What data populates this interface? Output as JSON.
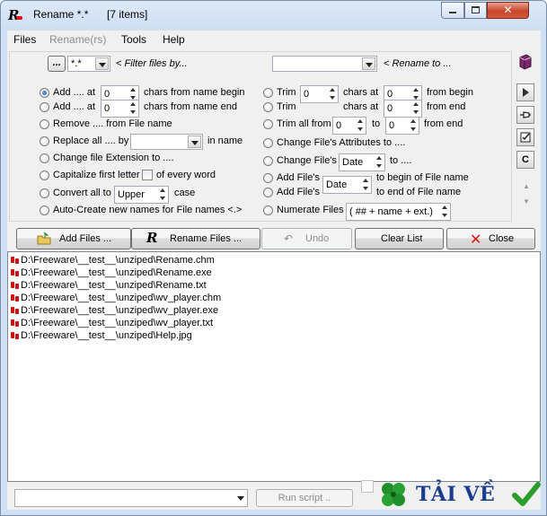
{
  "window": {
    "app_icon_letter": "R",
    "title": "Rename  *.*",
    "item_count": "[7 items]"
  },
  "menu": {
    "files": "Files",
    "rename": "Rename(rs)",
    "tools": "Tools",
    "help": "Help"
  },
  "filter": {
    "button_label": "...",
    "value": "*.*",
    "hint": "< Filter files by..."
  },
  "rename_to": {
    "value": "",
    "hint": "< Rename to ..."
  },
  "options": {
    "add_start": {
      "label": "Add .... at",
      "value": "0",
      "suffix": "chars from name begin",
      "checked": true
    },
    "add_end": {
      "label": "Add .... at",
      "value": "0",
      "suffix": "chars from name end"
    },
    "remove": {
      "label": "Remove  ....  from File name"
    },
    "replace": {
      "label": "Replace all .... by",
      "suffix": "in name",
      "value": ""
    },
    "change_ext": {
      "label": "Change file Extension to ...."
    },
    "capitalize": {
      "label": "Capitalize first letter",
      "check_label": "of every word"
    },
    "convert": {
      "label": "Convert all to",
      "value": "Upper",
      "suffix": "case"
    },
    "autocreate": {
      "label": "Auto-Create new names for File names <.>"
    },
    "trim": {
      "label": "Trim",
      "value": "0",
      "suffix": "chars at",
      "value2": "0",
      "suffix2": "from begin"
    },
    "trim2": {
      "label": "Trim",
      "suffix": "chars at",
      "value2": "0",
      "suffix2": "from  end"
    },
    "trim_all": {
      "label": "Trim all from",
      "value": "0",
      "to": "to",
      "value2": "0",
      "suffix": "from end"
    },
    "change_attr": {
      "label": "Change File's Attributes to  ...."
    },
    "change_date": {
      "label": "Change File's",
      "value": "Date",
      "suffix": "to  ...."
    },
    "add_files1": {
      "label": "Add File's",
      "suffix": "to begin of File name"
    },
    "add_files2": {
      "label": "Add File's",
      "value": "Date",
      "suffix": "to end of File name"
    },
    "numerate": {
      "label": "Numerate Files",
      "value": "( ## + name + ext.)"
    }
  },
  "side_toolbar": {
    "c_label": "C"
  },
  "actions": {
    "add_files": "Add Files ...",
    "rename_files": "Rename Files ...",
    "undo": "Undo",
    "clear_list": "Clear List",
    "close": "Close"
  },
  "files": [
    "D:\\Freeware\\__test__\\unziped\\Rename.chm",
    "D:\\Freeware\\__test__\\unziped\\Rename.exe",
    "D:\\Freeware\\__test__\\unziped\\Rename.txt",
    "D:\\Freeware\\__test__\\unziped\\wv_player.chm",
    "D:\\Freeware\\__test__\\unziped\\wv_player.exe",
    "D:\\Freeware\\__test__\\unziped\\wv_player.txt",
    "D:\\Freeware\\__test__\\unziped\\Help.jpg"
  ],
  "bottom": {
    "script_value": "",
    "run_script": "Run script ..",
    "brand": "TẢI VỀ"
  },
  "colors": {
    "accent_red": "#cc1010",
    "brand_blue": "#1a3d8e",
    "check_green": "#2a9d2a"
  }
}
